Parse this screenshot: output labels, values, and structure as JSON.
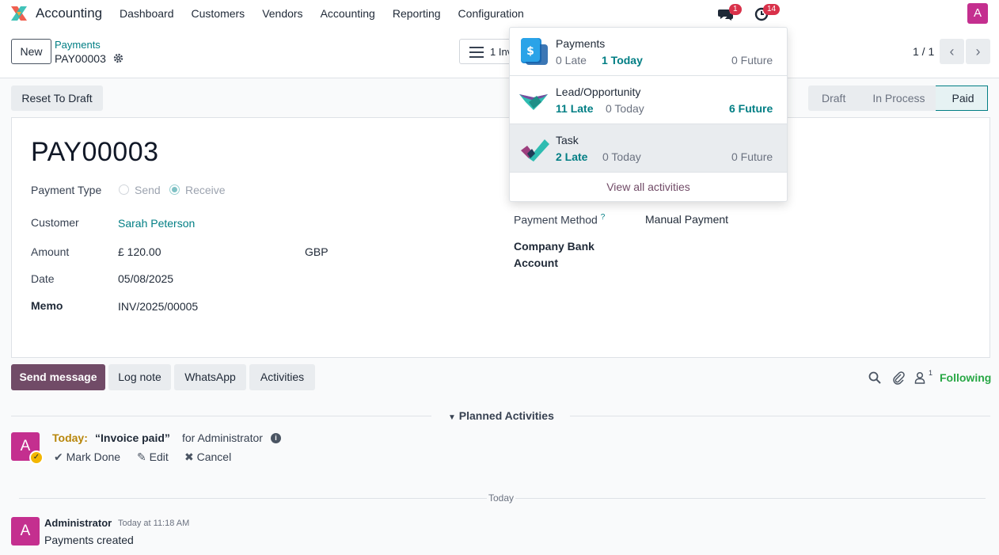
{
  "app": {
    "name": "Accounting",
    "menu": [
      "Dashboard",
      "Customers",
      "Vendors",
      "Accounting",
      "Reporting",
      "Configuration"
    ],
    "messages_badge": "1",
    "activities_badge": "14",
    "user_initial": "A",
    "colors": {
      "brand": "#714b67",
      "link": "#017e84",
      "avatar": "#c42f8f",
      "badge": "#d9314a",
      "following": "#28a745"
    }
  },
  "control": {
    "new_label": "New",
    "breadcrumb_parent": "Payments",
    "breadcrumb_current": "PAY00003",
    "smart_button_label": "1 Invoice",
    "pager": "1 / 1"
  },
  "status": {
    "reset_label": "Reset To Draft",
    "stages": [
      "Draft",
      "In Process",
      "Paid"
    ],
    "current": "Paid"
  },
  "form": {
    "title": "PAY00003",
    "payment_type_label": "Payment Type",
    "payment_type_options": [
      "Send",
      "Receive"
    ],
    "payment_type_selected": "Receive",
    "customer_label": "Customer",
    "customer_value": "Sarah Peterson",
    "amount_label": "Amount",
    "amount_value": "£ 120.00",
    "currency_value": "GBP",
    "date_label": "Date",
    "date_value": "05/08/2025",
    "memo_label": "Memo",
    "memo_value": "INV/2025/00005",
    "payment_method_label": "Payment Method",
    "payment_method_help": "?",
    "payment_method_value": "Manual Payment",
    "bank_account_label_1": "Company Bank",
    "bank_account_label_2": "Account"
  },
  "chatter": {
    "send_message": "Send message",
    "log_note": "Log note",
    "whatsapp": "WhatsApp",
    "activities": "Activities",
    "followers_count": "1",
    "following": "Following",
    "planned_title": "Planned Activities",
    "activity": {
      "due": "Today:",
      "title": "“Invoice paid”",
      "assignee": "for Administrator",
      "mark_done": "Mark Done",
      "edit": "Edit",
      "cancel": "Cancel"
    },
    "date_separator": "Today",
    "message": {
      "author": "Administrator",
      "date": "Today at 11:18 AM",
      "body": "Payments created"
    }
  },
  "activity_dropdown": {
    "groups": [
      {
        "name": "Payments",
        "late": "0 Late",
        "today": "1 Today",
        "future": "0 Future"
      },
      {
        "name": "Lead/Opportunity",
        "late": "11 Late",
        "today": "0 Today",
        "future": "6 Future"
      },
      {
        "name": "Task",
        "late": "2 Late",
        "today": "0 Today",
        "future": "0 Future"
      }
    ],
    "view_all": "View all activities"
  }
}
